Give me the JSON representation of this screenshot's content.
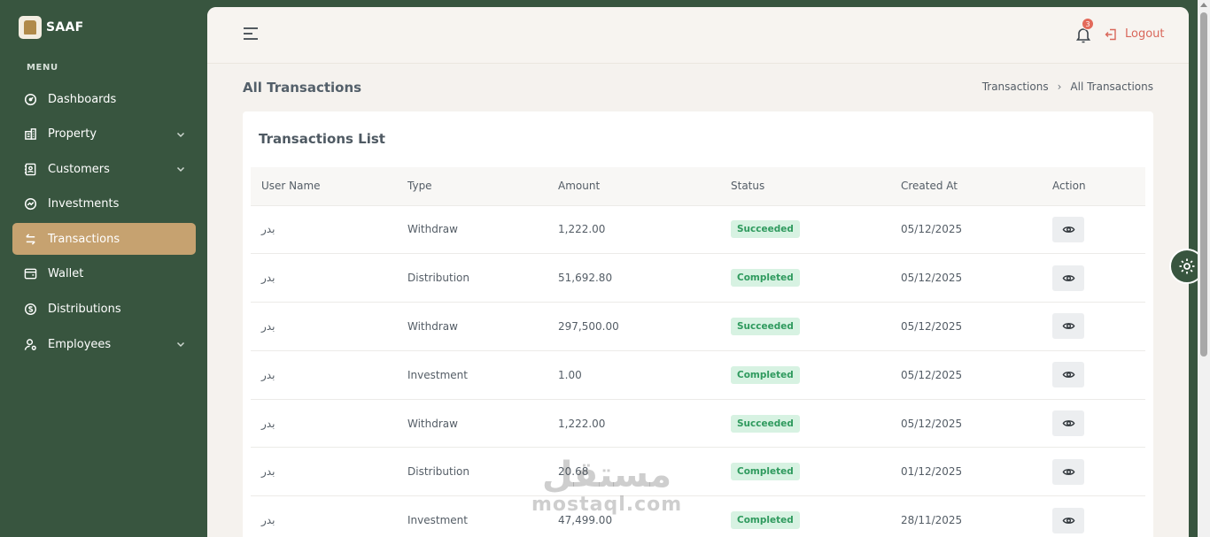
{
  "brand": {
    "name": "SAAF"
  },
  "sidebar": {
    "menu_title": "MENU",
    "items": [
      {
        "label": "Dashboards",
        "icon": "gauge-icon",
        "expandable": false,
        "active": false
      },
      {
        "label": "Property",
        "icon": "building-icon",
        "expandable": true,
        "active": false
      },
      {
        "label": "Customers",
        "icon": "contact-card-icon",
        "expandable": true,
        "active": false
      },
      {
        "label": "Investments",
        "icon": "chart-circle-icon",
        "expandable": false,
        "active": false
      },
      {
        "label": "Transactions",
        "icon": "arrows-swap-icon",
        "expandable": false,
        "active": true
      },
      {
        "label": "Wallet",
        "icon": "wallet-icon",
        "expandable": false,
        "active": false
      },
      {
        "label": "Distributions",
        "icon": "currency-circle-icon",
        "expandable": false,
        "active": false
      },
      {
        "label": "Employees",
        "icon": "user-gear-icon",
        "expandable": true,
        "active": false
      }
    ]
  },
  "topbar": {
    "notification_count": "3",
    "logout_label": "Logout"
  },
  "page": {
    "title": "All Transactions",
    "breadcrumb": [
      "Transactions",
      "All Transactions"
    ]
  },
  "card": {
    "title": "Transactions List",
    "columns": [
      "User Name",
      "Type",
      "Amount",
      "Status",
      "Created At",
      "Action"
    ],
    "rows": [
      {
        "user": "بدر",
        "type": "Withdraw",
        "amount": "1,222.00",
        "status": "Succeeded",
        "created": "05/12/2025"
      },
      {
        "user": "بدر",
        "type": "Distribution",
        "amount": "51,692.80",
        "status": "Completed",
        "created": "05/12/2025"
      },
      {
        "user": "بدر",
        "type": "Withdraw",
        "amount": "297,500.00",
        "status": "Succeeded",
        "created": "05/12/2025"
      },
      {
        "user": "بدر",
        "type": "Investment",
        "amount": "1.00",
        "status": "Completed",
        "created": "05/12/2025"
      },
      {
        "user": "بدر",
        "type": "Withdraw",
        "amount": "1,222.00",
        "status": "Succeeded",
        "created": "05/12/2025"
      },
      {
        "user": "بدر",
        "type": "Distribution",
        "amount": "20.68",
        "status": "Completed",
        "created": "01/12/2025"
      },
      {
        "user": "بدر",
        "type": "Investment",
        "amount": "47,499.00",
        "status": "Completed",
        "created": "28/11/2025"
      }
    ]
  },
  "watermark": {
    "arabic": "مستقل",
    "latin": "mostaql.com"
  },
  "colors": {
    "sidebar_bg": "#38553f",
    "active_item": "#c6a270",
    "logout": "#d9675a",
    "badge_text": "#2f9a5e",
    "badge_bg": "#d7f2e2",
    "notification_badge": "#e36a5b"
  }
}
